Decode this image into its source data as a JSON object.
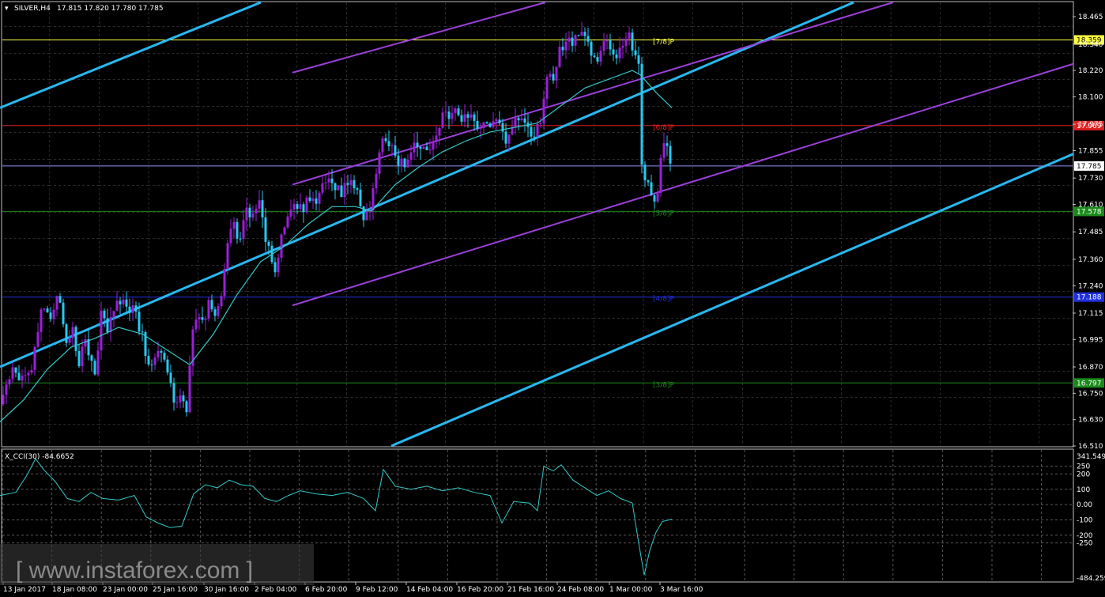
{
  "header": {
    "symbol_label": "SILVER,H4",
    "ohlc": "17.815 17.820 17.780 17.785"
  },
  "indicator": {
    "label": "X_CCI(30) -84.6652",
    "axis_labels": [
      "341.5497",
      "250",
      "200",
      "100",
      "0.00",
      "-100",
      "-200",
      "-250",
      "-484.2597"
    ]
  },
  "watermark": {
    "text": "[ www.instaforex.com ]"
  },
  "colors": {
    "background": "#000000",
    "grid": "#5a5a5a",
    "bull": "#9a1fd8",
    "bear": "#28c8f0",
    "ma": "#35c8c8",
    "channel_blue": "#28b8f0",
    "channel_purple": "#9b40d8",
    "level_7_8": "#ffff40",
    "level_6_8": "#e02020",
    "level_5_8": "#1a8a1a",
    "level_4_8": "#2030e0",
    "level_3_8": "#1a8a1a",
    "current_line": "#9090ff",
    "cci_line": "#35c8c8"
  },
  "chart_data": [
    {
      "type": "candlestick",
      "title": "SILVER,H4",
      "ylim": [
        16.51,
        18.53
      ],
      "y_ticks": [
        "18.465",
        "18.340",
        "18.220",
        "18.100",
        "17.975",
        "17.855",
        "17.730",
        "17.610",
        "17.485",
        "17.360",
        "17.240",
        "17.115",
        "16.995",
        "16.870",
        "16.750",
        "16.630",
        "16.510"
      ],
      "x_ticks": [
        "13 Jan 2017",
        "18 Jan 08:00",
        "23 Jan 00:00",
        "25 Jan 16:00",
        "30 Jan 16:00",
        "2 Feb 04:00",
        "6 Feb 20:00",
        "9 Feb 12:00",
        "14 Feb 04:00",
        "16 Feb 20:00",
        "21 Feb 16:00",
        "24 Feb 08:00",
        "1 Mar 00:00",
        "3 Mar 16:00"
      ],
      "current_price": "17.785",
      "levels": [
        {
          "name": "[7/8]P",
          "value": 18.359,
          "label": "18.359",
          "color_key": "level_7_8"
        },
        {
          "name": "[6/8]P",
          "value": 17.969,
          "label": "17.969",
          "color_key": "level_6_8"
        },
        {
          "name": "[5/8]P",
          "value": 17.578,
          "label": "17.578",
          "color_key": "level_5_8"
        },
        {
          "name": "[4/8]P",
          "value": 17.188,
          "label": "17.188",
          "color_key": "level_4_8"
        },
        {
          "name": "[3/8]P",
          "value": 16.797,
          "label": "16.797",
          "color_key": "level_3_8"
        }
      ],
      "close_path": [
        [
          0,
          16.7
        ],
        [
          8,
          16.8
        ],
        [
          14,
          16.85
        ],
        [
          22,
          16.82
        ],
        [
          30,
          16.86
        ],
        [
          38,
          16.8
        ],
        [
          44,
          16.95
        ],
        [
          50,
          17.1
        ],
        [
          58,
          17.15
        ],
        [
          66,
          17.1
        ],
        [
          74,
          17.25
        ],
        [
          80,
          17.05
        ],
        [
          86,
          16.98
        ],
        [
          92,
          17.05
        ],
        [
          98,
          16.85
        ],
        [
          106,
          17.0
        ],
        [
          112,
          16.95
        ],
        [
          120,
          16.85
        ],
        [
          128,
          17.1
        ],
        [
          136,
          17.05
        ],
        [
          144,
          17.15
        ],
        [
          152,
          17.18
        ],
        [
          160,
          17.12
        ],
        [
          168,
          17.15
        ],
        [
          176,
          17.05
        ],
        [
          184,
          16.95
        ],
        [
          190,
          16.85
        ],
        [
          198,
          16.95
        ],
        [
          206,
          16.9
        ],
        [
          214,
          16.8
        ],
        [
          220,
          16.7
        ],
        [
          228,
          16.72
        ],
        [
          236,
          16.68
        ],
        [
          244,
          17.05
        ],
        [
          250,
          17.1
        ],
        [
          258,
          17.05
        ],
        [
          264,
          17.15
        ],
        [
          272,
          17.1
        ],
        [
          280,
          17.2
        ],
        [
          288,
          17.45
        ],
        [
          296,
          17.5
        ],
        [
          304,
          17.45
        ],
        [
          312,
          17.6
        ],
        [
          320,
          17.55
        ],
        [
          328,
          17.62
        ],
        [
          336,
          17.45
        ],
        [
          344,
          17.35
        ],
        [
          350,
          17.3
        ],
        [
          358,
          17.5
        ],
        [
          366,
          17.55
        ],
        [
          374,
          17.6
        ],
        [
          382,
          17.58
        ],
        [
          390,
          17.65
        ],
        [
          398,
          17.62
        ],
        [
          406,
          17.68
        ],
        [
          414,
          17.7
        ],
        [
          422,
          17.72
        ],
        [
          430,
          17.65
        ],
        [
          438,
          17.72
        ],
        [
          446,
          17.7
        ],
        [
          454,
          17.65
        ],
        [
          460,
          17.55
        ],
        [
          466,
          17.55
        ],
        [
          474,
          17.7
        ],
        [
          482,
          17.88
        ],
        [
          488,
          17.9
        ],
        [
          496,
          17.85
        ],
        [
          504,
          17.8
        ],
        [
          512,
          17.78
        ],
        [
          520,
          17.85
        ],
        [
          528,
          17.9
        ],
        [
          536,
          17.88
        ],
        [
          544,
          17.85
        ],
        [
          552,
          17.9
        ],
        [
          560,
          18.0
        ],
        [
          568,
          18.02
        ],
        [
          576,
          18.05
        ],
        [
          584,
          18.0
        ],
        [
          592,
          18.02
        ],
        [
          600,
          17.98
        ],
        [
          608,
          17.95
        ],
        [
          616,
          17.98
        ],
        [
          624,
          18.0
        ],
        [
          632,
          17.95
        ],
        [
          640,
          17.9
        ],
        [
          646,
          17.95
        ],
        [
          654,
          18.0
        ],
        [
          662,
          17.98
        ],
        [
          670,
          17.95
        ],
        [
          678,
          17.92
        ],
        [
          684,
          18.0
        ],
        [
          692,
          18.2
        ],
        [
          700,
          18.15
        ],
        [
          708,
          18.3
        ],
        [
          716,
          18.35
        ],
        [
          724,
          18.35
        ],
        [
          732,
          18.38
        ],
        [
          740,
          18.36
        ],
        [
          748,
          18.3
        ],
        [
          756,
          18.28
        ],
        [
          764,
          18.38
        ],
        [
          772,
          18.32
        ],
        [
          780,
          18.3
        ],
        [
          788,
          18.36
        ],
        [
          796,
          18.38
        ],
        [
          804,
          18.3
        ],
        [
          808,
          18.25
        ],
        [
          812,
          17.8
        ],
        [
          818,
          17.7
        ],
        [
          824,
          17.65
        ],
        [
          830,
          17.62
        ],
        [
          836,
          17.8
        ],
        [
          842,
          17.92
        ],
        [
          848,
          17.8
        ]
      ],
      "ma_path": [
        [
          0,
          16.62
        ],
        [
          30,
          16.72
        ],
        [
          60,
          16.86
        ],
        [
          90,
          16.96
        ],
        [
          120,
          17.0
        ],
        [
          150,
          17.05
        ],
        [
          180,
          17.02
        ],
        [
          210,
          16.95
        ],
        [
          240,
          16.88
        ],
        [
          270,
          17.02
        ],
        [
          300,
          17.2
        ],
        [
          330,
          17.35
        ],
        [
          360,
          17.42
        ],
        [
          390,
          17.52
        ],
        [
          420,
          17.6
        ],
        [
          450,
          17.6
        ],
        [
          470,
          17.58
        ],
        [
          500,
          17.7
        ],
        [
          530,
          17.78
        ],
        [
          560,
          17.85
        ],
        [
          590,
          17.9
        ],
        [
          620,
          17.94
        ],
        [
          650,
          17.96
        ],
        [
          680,
          17.98
        ],
        [
          710,
          18.06
        ],
        [
          740,
          18.14
        ],
        [
          770,
          18.18
        ],
        [
          800,
          18.22
        ],
        [
          810,
          18.2
        ],
        [
          830,
          18.12
        ],
        [
          850,
          18.05
        ]
      ],
      "trend_lines": [
        {
          "color_key": "channel_blue",
          "x1": 0,
          "y1": 18.05,
          "x2": 330,
          "y2": 18.53
        },
        {
          "color_key": "channel_blue",
          "x1": 0,
          "y1": 16.87,
          "x2": 1080,
          "y2": 18.53
        },
        {
          "color_key": "channel_blue",
          "x1": 495,
          "y1": 16.51,
          "x2": 1358,
          "y2": 17.84
        },
        {
          "color_key": "channel_purple",
          "x1": 370,
          "y1": 18.21,
          "x2": 690,
          "y2": 18.53
        },
        {
          "color_key": "channel_purple",
          "x1": 370,
          "y1": 17.7,
          "x2": 1130,
          "y2": 18.53
        },
        {
          "color_key": "channel_purple",
          "x1": 370,
          "y1": 17.15,
          "x2": 1358,
          "y2": 18.25
        }
      ]
    },
    {
      "type": "line",
      "title": "X_CCI(30) -84.6652",
      "ylim": [
        -484.2597,
        341.5497
      ],
      "y_ticks": [
        "341.5497",
        "250",
        "200",
        "100",
        "0.00",
        "-100",
        "-200",
        "-250",
        "-484.2597"
      ],
      "series": [
        {
          "values": [
            [
              0,
              60
            ],
            [
              20,
              80
            ],
            [
              35,
              200
            ],
            [
              45,
              300
            ],
            [
              55,
              230
            ],
            [
              70,
              150
            ],
            [
              85,
              40
            ],
            [
              100,
              20
            ],
            [
              115,
              80
            ],
            [
              130,
              40
            ],
            [
              150,
              30
            ],
            [
              170,
              60
            ],
            [
              185,
              -80
            ],
            [
              200,
              -120
            ],
            [
              215,
              -150
            ],
            [
              230,
              -140
            ],
            [
              245,
              70
            ],
            [
              260,
              130
            ],
            [
              275,
              110
            ],
            [
              290,
              160
            ],
            [
              305,
              130
            ],
            [
              320,
              120
            ],
            [
              335,
              40
            ],
            [
              350,
              20
            ],
            [
              365,
              60
            ],
            [
              380,
              90
            ],
            [
              400,
              70
            ],
            [
              420,
              60
            ],
            [
              440,
              80
            ],
            [
              460,
              40
            ],
            [
              475,
              -40
            ],
            [
              485,
              230
            ],
            [
              500,
              120
            ],
            [
              520,
              100
            ],
            [
              540,
              120
            ],
            [
              560,
              90
            ],
            [
              580,
              110
            ],
            [
              600,
              80
            ],
            [
              620,
              60
            ],
            [
              635,
              -120
            ],
            [
              650,
              20
            ],
            [
              670,
              10
            ],
            [
              680,
              -40
            ],
            [
              688,
              250
            ],
            [
              700,
              220
            ],
            [
              710,
              260
            ],
            [
              725,
              160
            ],
            [
              740,
              110
            ],
            [
              755,
              60
            ],
            [
              770,
              90
            ],
            [
              785,
              40
            ],
            [
              800,
              10
            ],
            [
              808,
              -250
            ],
            [
              815,
              -460
            ],
            [
              822,
              -300
            ],
            [
              830,
              -180
            ],
            [
              838,
              -110
            ],
            [
              850,
              -95
            ]
          ]
        }
      ]
    }
  ]
}
